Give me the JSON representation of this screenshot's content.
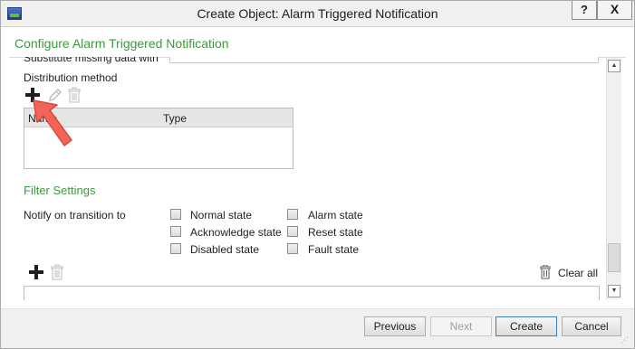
{
  "window": {
    "title": "Create Object: Alarm Triggered Notification",
    "help_label": "?",
    "close_label": "X"
  },
  "header": {
    "title": "Configure Alarm Triggered Notification"
  },
  "form": {
    "substitute_label": "Substitute missing data with",
    "distribution_label": "Distribution method",
    "table_columns": [
      "Name",
      "Type"
    ],
    "filter_section_title": "Filter Settings",
    "notify_label": "Notify on transition to",
    "states": [
      {
        "label": "Normal state",
        "checked": false
      },
      {
        "label": "Alarm state",
        "checked": false
      },
      {
        "label": "Acknowledge state",
        "checked": false
      },
      {
        "label": "Reset state",
        "checked": false
      },
      {
        "label": "Disabled state",
        "checked": false
      },
      {
        "label": "Fault state",
        "checked": false
      }
    ],
    "clear_all_label": "Clear all"
  },
  "icons": {
    "add": "plus-icon",
    "edit": "pencil-icon",
    "delete": "trash-icon",
    "clear": "clear-all-icon"
  },
  "footer": {
    "previous_label": "Previous",
    "next_label": "Next",
    "create_label": "Create",
    "cancel_label": "Cancel"
  },
  "colors": {
    "section_title": "#3c9a3c",
    "annotation_arrow": "#f26456"
  }
}
